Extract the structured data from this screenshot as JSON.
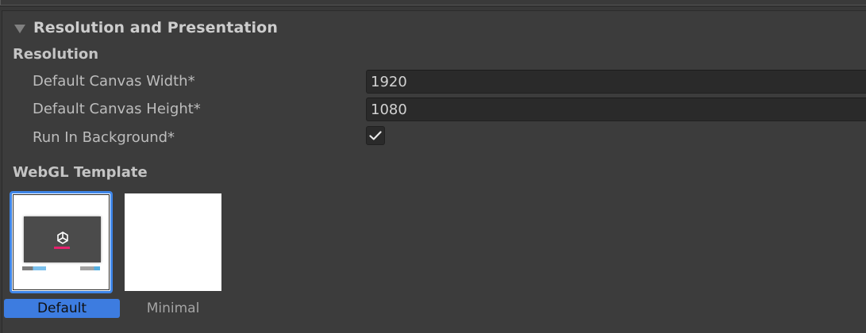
{
  "section": {
    "title": "Resolution and Presentation"
  },
  "resolution": {
    "heading": "Resolution",
    "fields": {
      "canvas_width": {
        "label": "Default Canvas Width*",
        "value": "1920"
      },
      "canvas_height": {
        "label": "Default Canvas Height*",
        "value": "1080"
      },
      "run_in_background": {
        "label": "Run In Background*",
        "checked": true
      }
    }
  },
  "webgl_template": {
    "heading": "WebGL Template",
    "templates": [
      {
        "label": "Default",
        "selected": true
      },
      {
        "label": "Minimal",
        "selected": false
      }
    ]
  },
  "colors": {
    "selection_accent": "#3d7ce0",
    "selection_border": "#3f86e8",
    "panel_background": "#3c3c3c",
    "field_background": "#2a2a2a",
    "logo_bar": "#e6226e"
  },
  "icons": {
    "foldout": "triangle-down-icon",
    "checkbox": "checkmark-icon",
    "template_logo": "unity-logo-icon"
  }
}
